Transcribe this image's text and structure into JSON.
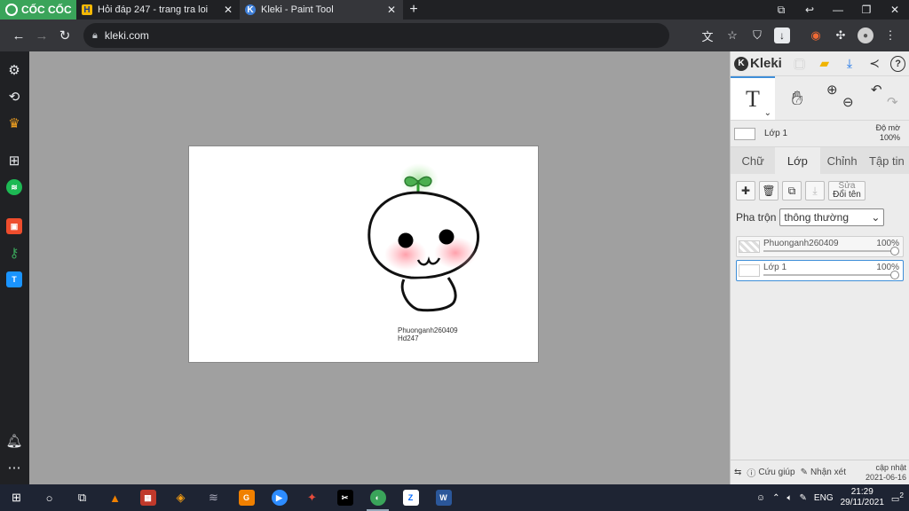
{
  "browser": {
    "brand": "CỐC CỐC",
    "tabs": [
      {
        "title": "Hỏi đáp 247 - trang tra loi",
        "favicon": "H"
      },
      {
        "title": "Kleki - Paint Tool",
        "favicon": "K"
      }
    ],
    "url": "kleki.com"
  },
  "canvas": {
    "signature_line1": "Phuonganh260409",
    "signature_line2": "Hd247"
  },
  "kleki": {
    "logo": "Kleki",
    "current_layer": "Lớp 1",
    "opacity_label": "Độ mờ",
    "opacity_value": "100%",
    "tabs": [
      "Chữ",
      "Lớp",
      "Chỉnh",
      "Tập tin"
    ],
    "rename_top": "Sửa",
    "rename_bottom": "Đổi tên",
    "blend_label": "Pha trộn",
    "blend_value": "thông thường",
    "layers": [
      {
        "name": "Phuonganh260409",
        "opacity": "100%"
      },
      {
        "name": "Lớp 1",
        "opacity": "100%"
      }
    ],
    "footer": {
      "help": "Cứu giúp",
      "feedback": "Nhận xét",
      "update_label": "cập nhật",
      "update_date": "2021-06-16"
    }
  },
  "taskbar": {
    "lang": "ENG",
    "time": "21:29",
    "date": "29/11/2021",
    "notifications": "2"
  },
  "colors": {
    "coccoc_green": "#3aa45a",
    "accent_blue": "#3f8fd8"
  }
}
